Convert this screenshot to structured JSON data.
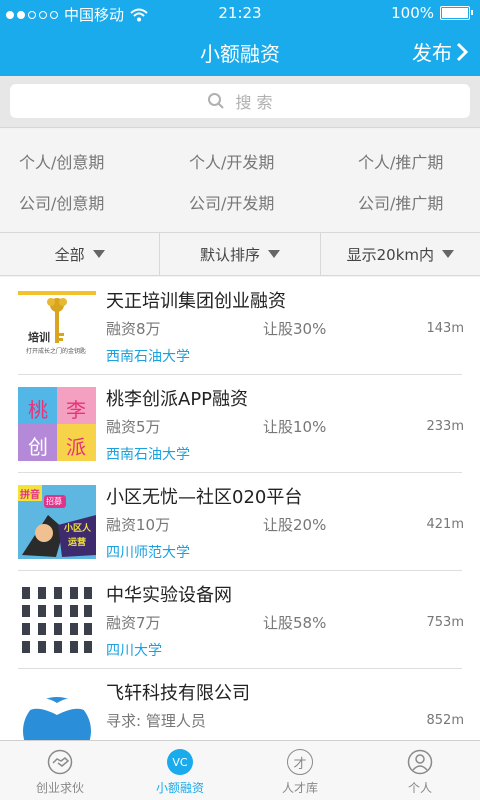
{
  "status": {
    "carrier": "中国移动",
    "time": "21:23",
    "battery": "100%"
  },
  "header": {
    "title": "小额融资",
    "publish_label": "发布"
  },
  "search": {
    "placeholder": "搜 索"
  },
  "categories": [
    "个人/创意期",
    "个人/开发期",
    "个人/推广期",
    "公司/创意期",
    "公司/开发期",
    "公司/推广期"
  ],
  "filters": [
    {
      "label": "全部",
      "icon": "dropdown-triangle-icon"
    },
    {
      "label": "默认排序",
      "icon": "dropdown-triangle-icon"
    },
    {
      "label": "显示20km内",
      "icon": "dropdown-triangle-icon"
    }
  ],
  "items": [
    {
      "name": "天正培训集团创业融资",
      "amount": "融资8万",
      "share": "让股30%",
      "distance": "143m",
      "school": "西南石油大学",
      "thumb_text": "培训",
      "thumb_caption": "打开成长之门的金钥匙"
    },
    {
      "name": "桃李创派APP融资",
      "amount": "融资5万",
      "share": "让股10%",
      "distance": "233m",
      "school": "西南石油大学",
      "thumb_chars": [
        "桃",
        "李",
        "创",
        "派"
      ]
    },
    {
      "name": "小区无忧—社区020平台",
      "amount": "融资10万",
      "share": "让股20%",
      "distance": "421m",
      "school": "四川师范大学",
      "thumb_tags": [
        "拼音",
        "招募",
        "小区人",
        "运营"
      ]
    },
    {
      "name": "中华实验设备网",
      "amount": "融资7万",
      "share": "让股58%",
      "distance": "753m",
      "school": "四川大学"
    },
    {
      "name": "飞轩科技有限公司",
      "amount": "寻求: 管理人员",
      "share": "",
      "distance": "852m",
      "school": ""
    }
  ],
  "tabs": [
    {
      "label": "创业求伙",
      "icon": "handshake-icon",
      "active": false
    },
    {
      "label": "小额融资",
      "icon": "vc-icon",
      "icon_text": "VC",
      "active": true
    },
    {
      "label": "人才库",
      "icon": "talent-icon",
      "icon_text": "才",
      "active": false
    },
    {
      "label": "个人",
      "icon": "person-icon",
      "active": false
    }
  ],
  "colors": {
    "brand": "#1aabec",
    "link": "#1aa1de"
  }
}
